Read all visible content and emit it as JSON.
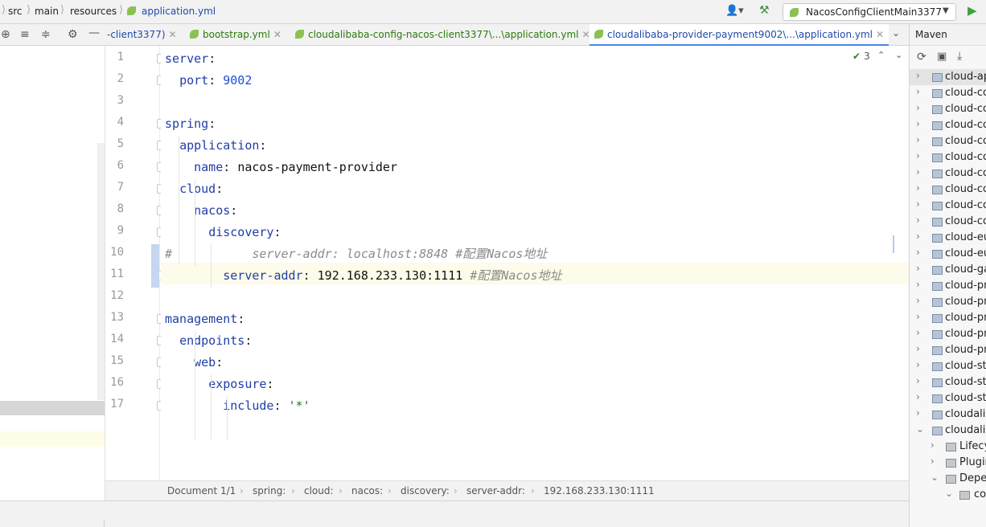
{
  "breadcrumb": {
    "items": [
      "src",
      "main",
      "resources",
      "application.yml"
    ]
  },
  "run_config": {
    "label": "NacosConfigClientMain3377"
  },
  "tabs": [
    {
      "label": "-client3377)",
      "active": false
    },
    {
      "label": "bootstrap.yml",
      "active": false
    },
    {
      "label": "cloudalibaba-config-nacos-client3377\\...\\application.yml",
      "active": false
    },
    {
      "label": "cloudalibaba-provider-payment9002\\...\\application.yml",
      "active": true
    }
  ],
  "inspection": {
    "count": "3"
  },
  "editor": {
    "lines": [
      {
        "num": "1",
        "indent": 0,
        "key": "server",
        "value": "",
        "comment": ""
      },
      {
        "num": "2",
        "indent": 1,
        "key": "port",
        "value": "9002",
        "vtype": "number",
        "comment": ""
      },
      {
        "num": "3",
        "indent": 0,
        "key": "",
        "value": "",
        "comment": ""
      },
      {
        "num": "4",
        "indent": 0,
        "key": "spring",
        "value": "",
        "comment": ""
      },
      {
        "num": "5",
        "indent": 1,
        "key": "application",
        "value": "",
        "comment": ""
      },
      {
        "num": "6",
        "indent": 2,
        "key": "name",
        "value": "nacos-payment-provider",
        "vtype": "plain",
        "comment": ""
      },
      {
        "num": "7",
        "indent": 1,
        "key": "cloud",
        "value": "",
        "comment": ""
      },
      {
        "num": "8",
        "indent": 2,
        "key": "nacos",
        "value": "",
        "comment": ""
      },
      {
        "num": "9",
        "indent": 3,
        "key": "discovery",
        "value": "",
        "comment": ""
      },
      {
        "num": "10",
        "commented": true,
        "text": "#           server-addr: localhost:8848 #配置Nacos地址"
      },
      {
        "num": "11",
        "indent": 4,
        "key": "server-addr",
        "value": "192.168.233.130:1111",
        "vtype": "plain",
        "comment": "#配置Nacos地址"
      },
      {
        "num": "12",
        "indent": 0,
        "key": "",
        "value": "",
        "comment": ""
      },
      {
        "num": "13",
        "indent": 0,
        "key": "management",
        "value": "",
        "comment": ""
      },
      {
        "num": "14",
        "indent": 1,
        "key": "endpoints",
        "value": "",
        "comment": ""
      },
      {
        "num": "15",
        "indent": 2,
        "key": "web",
        "value": "",
        "comment": ""
      },
      {
        "num": "16",
        "indent": 3,
        "key": "exposure",
        "value": "",
        "comment": ""
      },
      {
        "num": "17",
        "indent": 4,
        "key": "include",
        "value": "'*'",
        "vtype": "string",
        "comment": ""
      }
    ]
  },
  "status_breadcrumb": {
    "items": [
      "Document 1/1",
      "spring:",
      "cloud:",
      "nacos:",
      "discovery:",
      "server-addr:",
      "192.168.233.130:1111"
    ]
  },
  "maven": {
    "title": "Maven",
    "items": [
      {
        "label": "cloud-ap",
        "expanded": false
      },
      {
        "label": "cloud-co",
        "expanded": false
      },
      {
        "label": "cloud-co",
        "expanded": false
      },
      {
        "label": "cloud-co",
        "expanded": false
      },
      {
        "label": "cloud-co",
        "expanded": false
      },
      {
        "label": "cloud-co",
        "expanded": false
      },
      {
        "label": "cloud-co",
        "expanded": false
      },
      {
        "label": "cloud-co",
        "expanded": false
      },
      {
        "label": "cloud-co",
        "expanded": false
      },
      {
        "label": "cloud-co",
        "expanded": false
      },
      {
        "label": "cloud-eu",
        "expanded": false
      },
      {
        "label": "cloud-eu",
        "expanded": false
      },
      {
        "label": "cloud-ga",
        "expanded": false
      },
      {
        "label": "cloud-pro",
        "expanded": false
      },
      {
        "label": "cloud-pro",
        "expanded": false
      },
      {
        "label": "cloud-pro",
        "expanded": false
      },
      {
        "label": "cloud-pro",
        "expanded": false
      },
      {
        "label": "cloud-pro",
        "expanded": false
      },
      {
        "label": "cloud-str",
        "expanded": false
      },
      {
        "label": "cloud-str",
        "expanded": false
      },
      {
        "label": "cloud-str",
        "expanded": false
      },
      {
        "label": "cloudalib",
        "expanded": false
      },
      {
        "label": "cloudalib",
        "expanded": true
      }
    ],
    "children": [
      {
        "label": "Lifecyc"
      },
      {
        "label": "Plugin"
      },
      {
        "label": "Depen"
      },
      {
        "label": "co"
      }
    ]
  },
  "colors": {
    "accent": "#4a86e8",
    "leaf": "#8cc152",
    "key": "#1f3ea6",
    "number": "#1d4fd6",
    "string": "#187d1a",
    "comment": "#8a8a8a"
  }
}
